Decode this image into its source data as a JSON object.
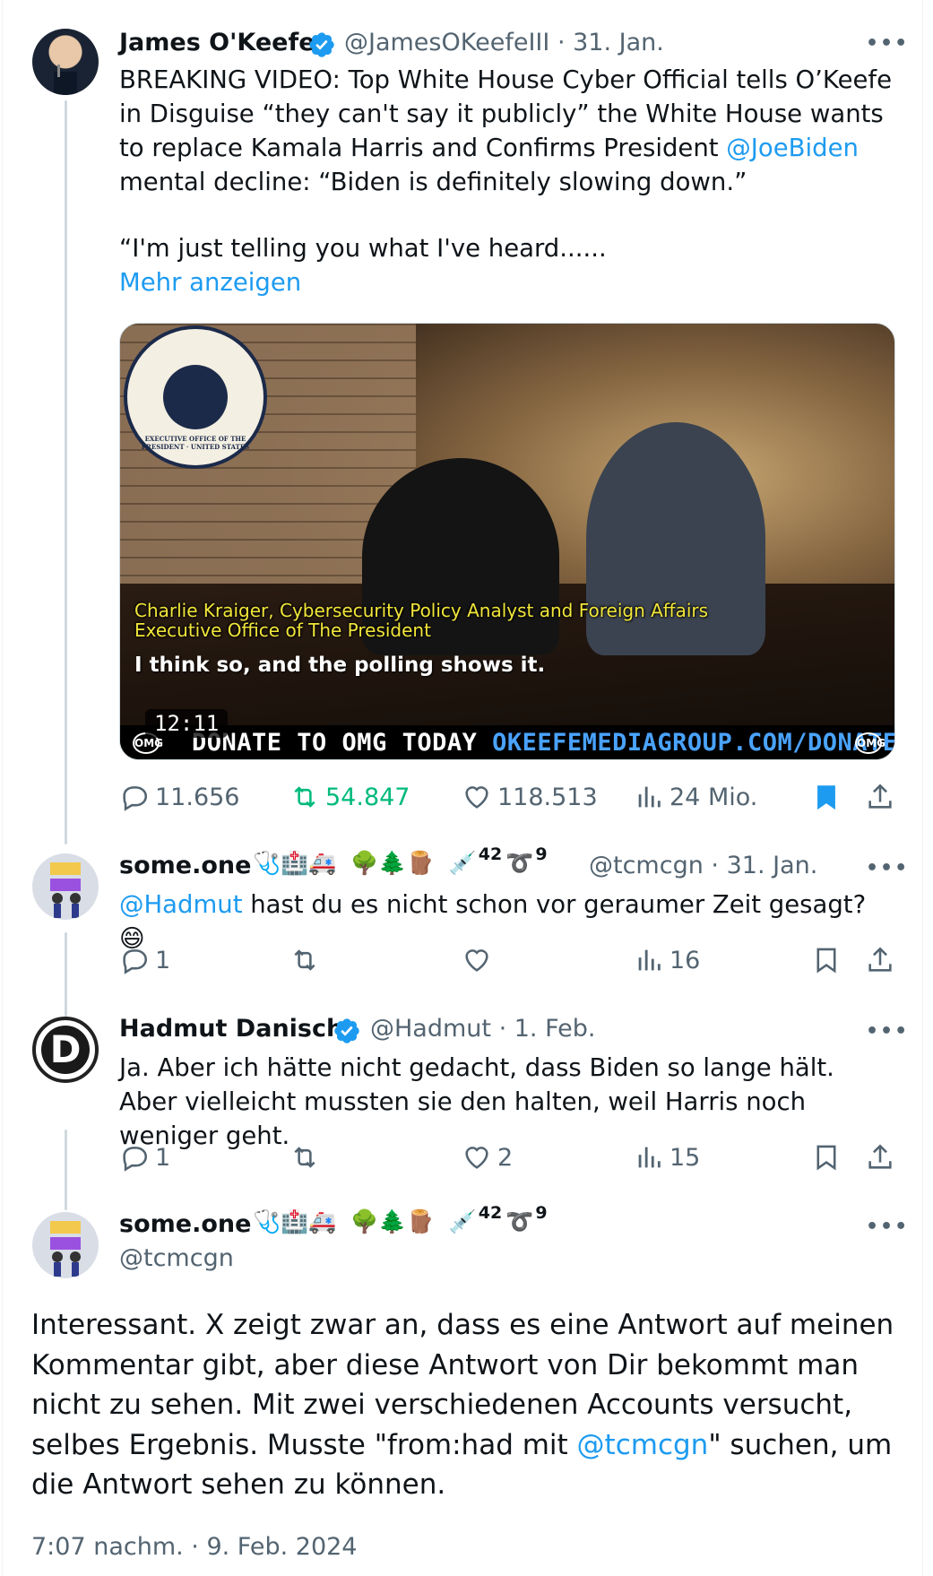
{
  "tweet1": {
    "name": "James O'Keefe",
    "handle": "@JamesOKeefeIII",
    "date": "· 31. Jan.",
    "text_part1": "BREAKING VIDEO: Top White House Cyber Official tells O’Keefe in Disguise “they can't say it publicly” the White House wants to replace Kamala Harris and Confirms President ",
    "mention": "@JoeBiden",
    "text_part2": " mental decline: “Biden is definitely slowing down.”",
    "text_part3": "“I'm just telling you what I've heard......",
    "show_more": "Mehr anzeigen",
    "media": {
      "seal_text": "EXECUTIVE OFFICE OF THE PRESIDENT · UNITED STATES",
      "caption_line1": "Charlie Kraiger, Cybersecurity Policy Analyst and Foreign Affairs",
      "caption_line2": "Executive Office of The President",
      "subtitle": "I think so, and the polling shows it.",
      "banner_left": "DONATE TO OMG TODAY ",
      "banner_url": "OKEEFEMEDIAGROUP.COM/DONATE",
      "logo": "OMG",
      "duration": "12:11"
    },
    "replies": "11.656",
    "reposts": "54.847",
    "likes": "118.513",
    "views": "24 Mio."
  },
  "tweet2": {
    "name": "some.one",
    "emojis_a": "🩺🏥🚑",
    "emojis_b": "🌳🌲🪵",
    "emoji_syringe": "💉",
    "sup1": "42",
    "emoji_loop": "➰",
    "sup2": "9",
    "handle": "@tcmcgn",
    "date": "· 31. Jan.",
    "mention": "@Hadmut",
    "text": " hast du es nicht schon vor geraumer Zeit gesagt? 😄",
    "replies": "1",
    "reposts": "",
    "likes": "",
    "views": "16"
  },
  "tweet3": {
    "name": "Hadmut Danisch",
    "avatar_letter": "D",
    "handle": "@Hadmut",
    "date": "· 1. Feb.",
    "text": "Ja. Aber ich hätte nicht gedacht, dass Biden so lange hält. Aber vielleicht mussten sie den halten, weil Harris noch weniger geht.",
    "replies": "1",
    "reposts": "",
    "likes": "2",
    "views": "15"
  },
  "tweet4": {
    "name": "some.one",
    "emojis_a": "🩺🏥🚑",
    "emojis_b": "🌳🌲🪵",
    "emoji_syringe": "💉",
    "sup1": "42",
    "emoji_loop": "➰",
    "sup2": "9",
    "handle": "@tcmcgn",
    "text_part1": "Interessant. X zeigt zwar an, dass es eine Antwort auf meinen Kommentar gibt, aber diese Antwort von Dir bekommt man nicht zu sehen. Mit zwei verschiedenen Accounts versucht, selbes Ergebnis. Musste \"from:had mit ",
    "mention": "@tcmcgn",
    "text_part2": "\" suchen, um die Antwort sehen zu können.",
    "timestamp": "7:07 nachm. · 9. Feb. 2024"
  },
  "more_label": "•••",
  "colors": {
    "accent": "#1d9bf0",
    "repost_active": "#00ba7c",
    "muted": "#536471"
  }
}
